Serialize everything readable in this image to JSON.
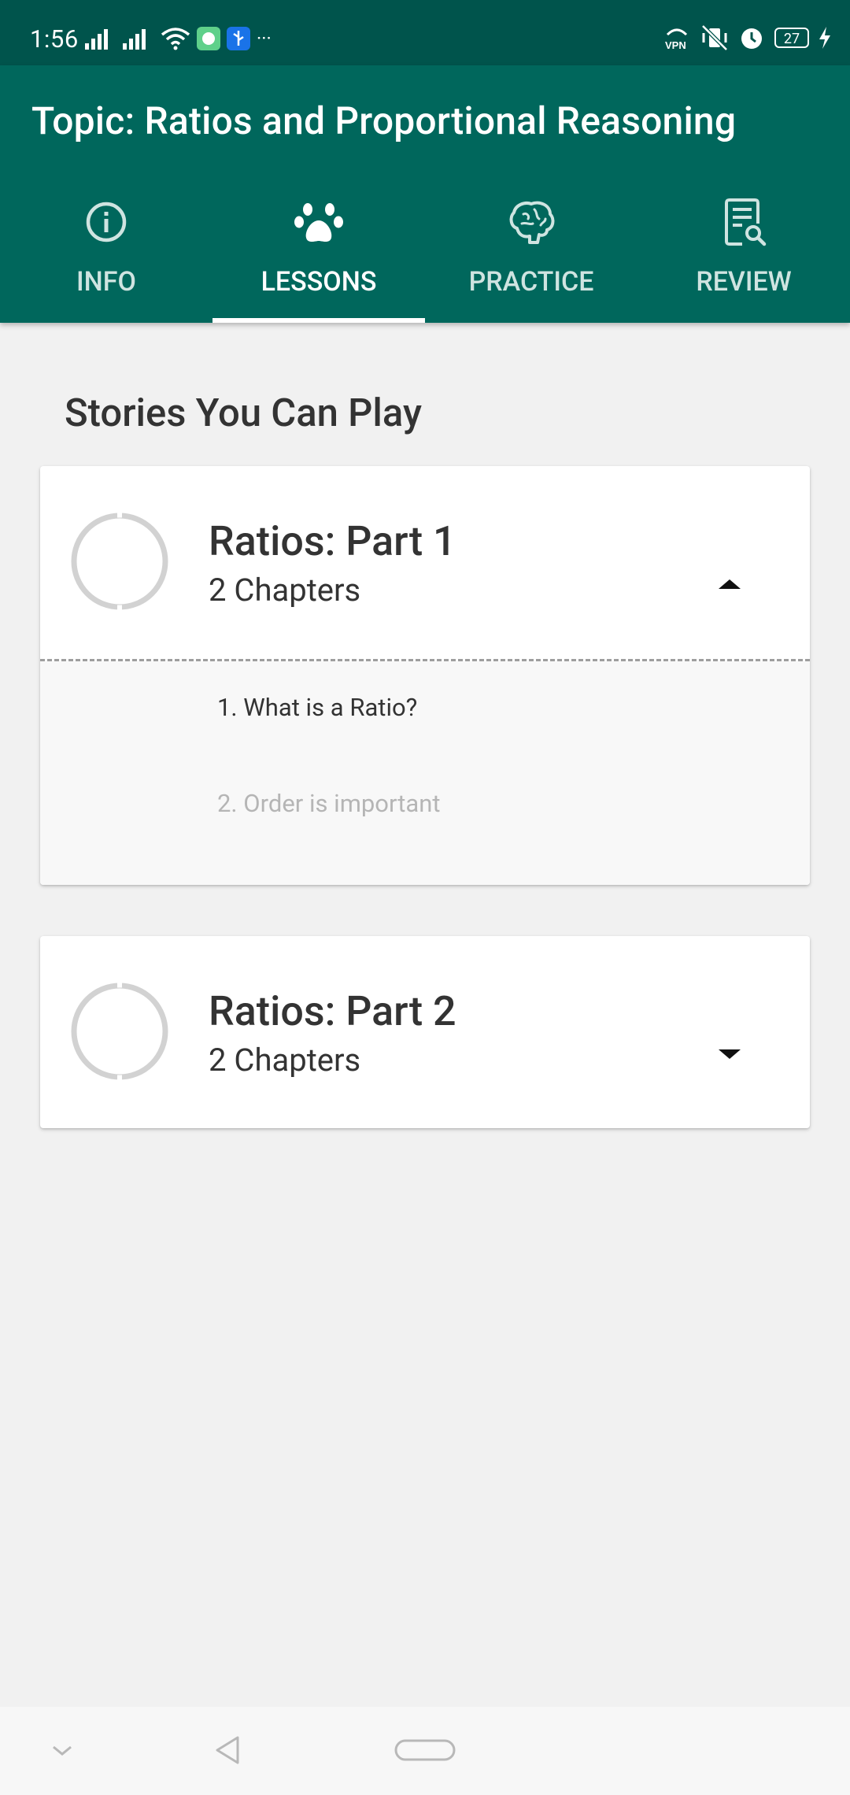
{
  "status_bar": {
    "time": "1:56",
    "battery": "27",
    "left_icons": [
      "signal-icon",
      "signal-icon",
      "wifi-icon",
      "app-notification-icon",
      "usb-icon",
      "more-icon"
    ],
    "right_icons": [
      "vpn-icon",
      "vibrate-off-icon",
      "alarm-icon",
      "battery-icon",
      "charging-icon"
    ]
  },
  "app_bar": {
    "title": "Topic: Ratios and Proportional Reasoning",
    "background": "#00675c"
  },
  "tabs": [
    {
      "label": "INFO",
      "icon": "info-icon",
      "active": false
    },
    {
      "label": "LESSONS",
      "icon": "paw-icon",
      "active": true
    },
    {
      "label": "PRACTICE",
      "icon": "brain-icon",
      "active": false
    },
    {
      "label": "REVIEW",
      "icon": "review-document-icon",
      "active": false
    }
  ],
  "section_title": "Stories You Can Play",
  "stories": [
    {
      "title": "Ratios: Part 1",
      "subtitle": "2 Chapters",
      "expanded": true,
      "chapters": [
        "1. What is a Ratio?",
        "2. Order is important"
      ],
      "chapter_enabled": [
        true,
        false
      ]
    },
    {
      "title": "Ratios: Part 2",
      "subtitle": "2 Chapters",
      "expanded": false
    }
  ],
  "nav_bar": {
    "icons": [
      "hide-nav-chevron-icon",
      "back-icon",
      "home-pill-icon"
    ]
  }
}
